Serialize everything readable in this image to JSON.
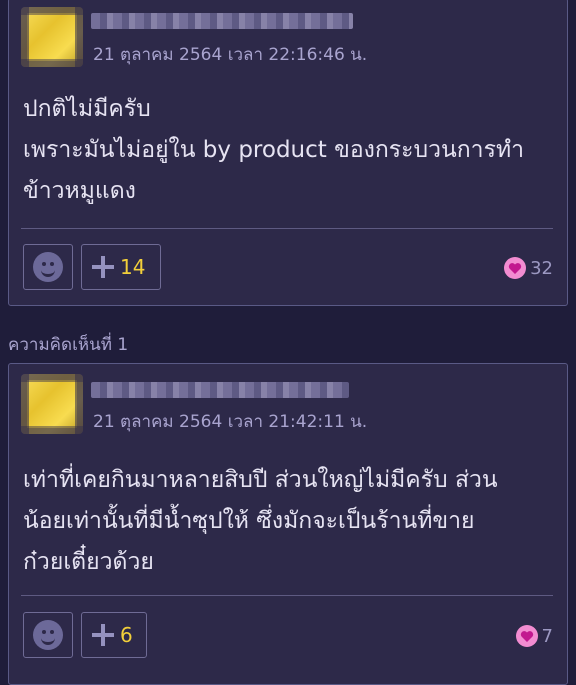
{
  "comments": [
    {
      "timestamp": "21 ตุลาคม 2564 เวลา 22:16:46 น.",
      "text_lines": [
        "ปกติไม่มีครับ",
        "เพราะมันไม่อยู่ใน by product ของกระบวนการทำ",
        "ข้าวหมูแดง"
      ],
      "plus_count": "14",
      "heart_count": "32"
    },
    {
      "timestamp": "21 ตุลาคม 2564 เวลา 21:42:11 น.",
      "text_lines": [
        "เท่าที่เคยกินมาหลายสิบปี ส่วนใหญ่ไม่มีครับ ส่วน",
        "น้อยเท่านั้นที่มีน้ำซุปให้ ซึ่งมักจะเป็นร้านที่ขาย",
        "ก๋วยเตี๋ยวด้วย"
      ],
      "plus_count": "6",
      "heart_count": "7"
    }
  ],
  "section_label": "ความคิดเห็นที่ 1",
  "colors": {
    "background": "#1f1d3a",
    "card": "#2d2949",
    "accent_count": "#f2cf3a",
    "heart": "#f28cd1"
  },
  "icons": [
    "smiley-icon",
    "plus-icon",
    "heart-icon"
  ]
}
